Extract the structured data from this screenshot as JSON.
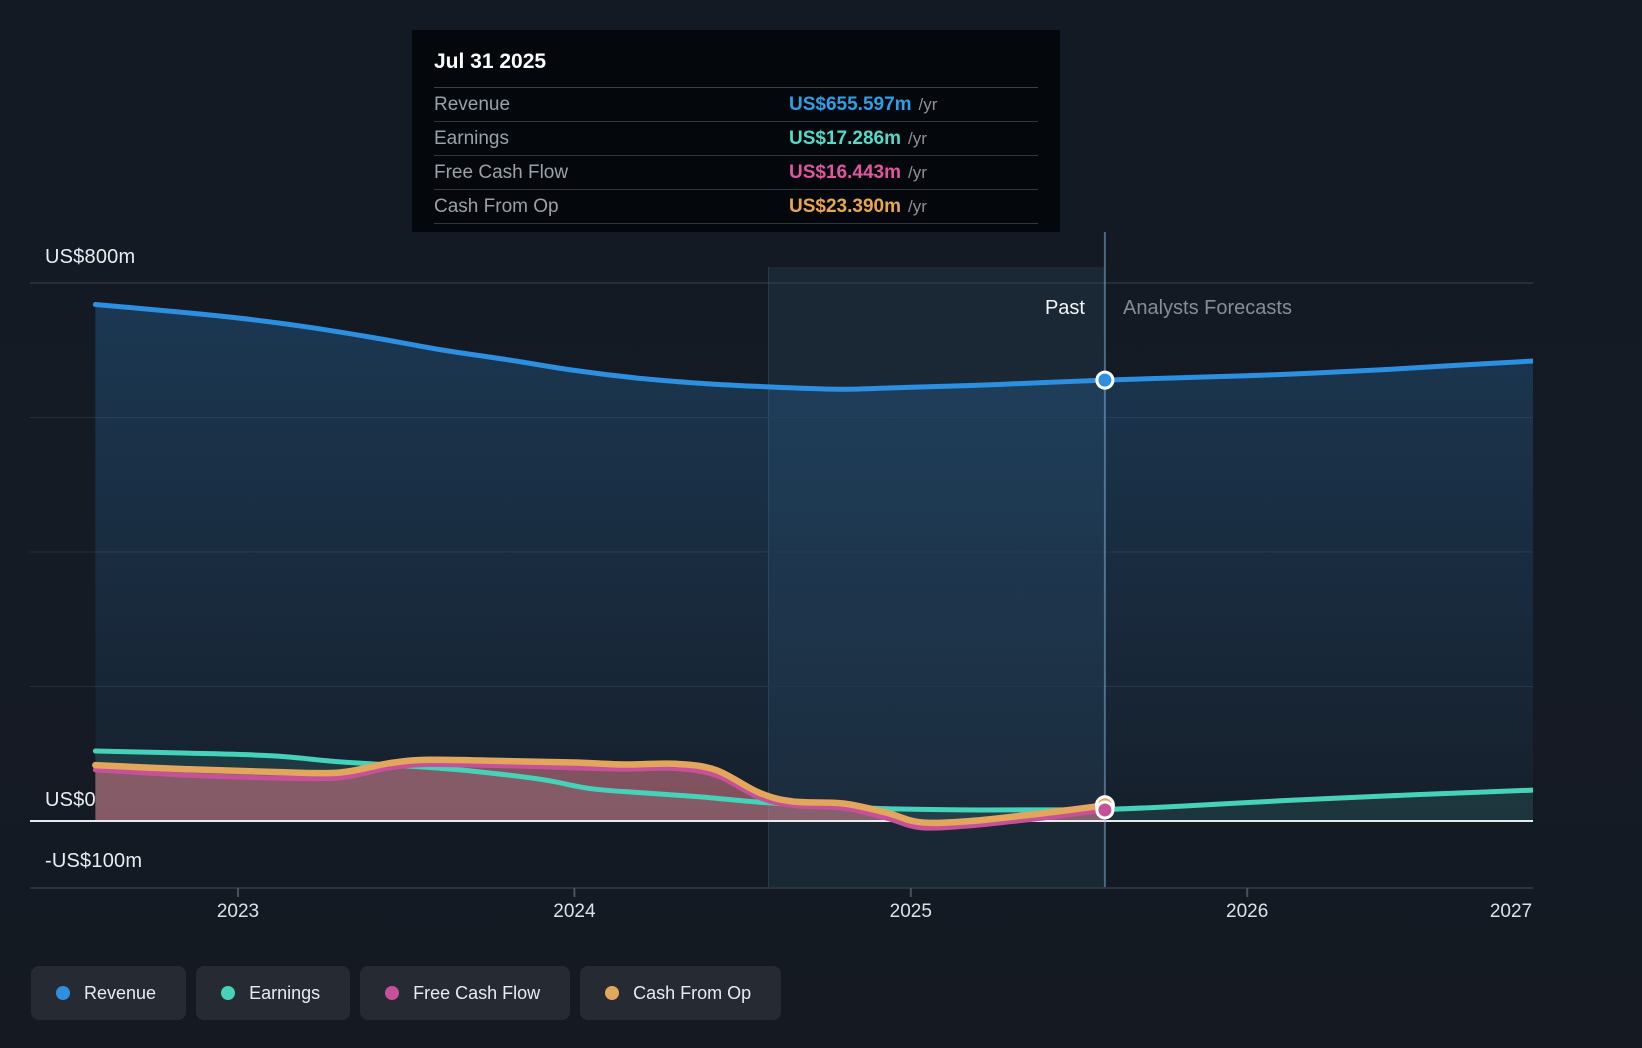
{
  "tooltip": {
    "date": "Jul 31 2025",
    "rows": [
      {
        "label": "Revenue",
        "value": "US$655.597m",
        "unit": "/yr",
        "color": "#2da0e8"
      },
      {
        "label": "Earnings",
        "value": "US$17.286m",
        "unit": "/yr",
        "color": "#52dcc8"
      },
      {
        "label": "Free Cash Flow",
        "value": "US$16.443m",
        "unit": "/yr",
        "color": "#e2559f"
      },
      {
        "label": "Cash From Op",
        "value": "US$23.390m",
        "unit": "/yr",
        "color": "#eaa64f"
      }
    ]
  },
  "annotations": {
    "past_label": "Past",
    "forecast_label": "Analysts Forecasts"
  },
  "y_axis": {
    "top_label": "US$800m",
    "zero_label": "US$0",
    "bottom_label": "-US$100m"
  },
  "legend": [
    {
      "label": "Revenue",
      "color": "#2d8fe0"
    },
    {
      "label": "Earnings",
      "color": "#46d2b9"
    },
    {
      "label": "Free Cash Flow",
      "color": "#c75198"
    },
    {
      "label": "Cash From Op",
      "color": "#e2a65c"
    }
  ],
  "chart_data": {
    "type": "area",
    "title": "Revenue, earnings and cash flow history and forecast (US$m)",
    "ylim": [
      -100,
      800
    ],
    "y_gridlines": [
      800,
      600,
      400,
      200,
      0
    ],
    "x_ticks": [
      2023,
      2024,
      2025,
      2026,
      2027
    ],
    "grid": true,
    "legend_position": "bottom",
    "divider_x": 2025.577,
    "highlight_band": [
      2024.577,
      2025.577
    ],
    "past_region_end": 2025.577,
    "series": [
      {
        "name": "Revenue",
        "color": "#2d8fe0",
        "points": [
          [
            2022.576,
            768
          ],
          [
            2022.8,
            758
          ],
          [
            2023.0,
            748
          ],
          [
            2023.2,
            735
          ],
          [
            2023.4,
            719
          ],
          [
            2023.6,
            701
          ],
          [
            2023.8,
            686
          ],
          [
            2024.0,
            670
          ],
          [
            2024.2,
            658
          ],
          [
            2024.4,
            650
          ],
          [
            2024.6,
            645
          ],
          [
            2024.8,
            642
          ],
          [
            2025.0,
            645
          ],
          [
            2025.2,
            648
          ],
          [
            2025.4,
            652
          ],
          [
            2025.577,
            655.597
          ],
          [
            2025.8,
            659
          ],
          [
            2026.1,
            664
          ],
          [
            2026.4,
            671
          ],
          [
            2026.6,
            677
          ],
          [
            2026.85,
            684
          ]
        ]
      },
      {
        "name": "Earnings",
        "color": "#46d2b9",
        "points": [
          [
            2022.576,
            104
          ],
          [
            2022.85,
            101
          ],
          [
            2023.1,
            97
          ],
          [
            2023.3,
            88
          ],
          [
            2023.5,
            82
          ],
          [
            2023.7,
            74
          ],
          [
            2023.9,
            62
          ],
          [
            2024.05,
            48
          ],
          [
            2024.2,
            42
          ],
          [
            2024.37,
            36
          ],
          [
            2024.55,
            28
          ],
          [
            2024.75,
            22
          ],
          [
            2024.95,
            18
          ],
          [
            2025.15,
            16.5
          ],
          [
            2025.35,
            16.5
          ],
          [
            2025.577,
            17.286
          ],
          [
            2025.8,
            22
          ],
          [
            2026.1,
            30
          ],
          [
            2026.4,
            37
          ],
          [
            2026.6,
            41
          ],
          [
            2026.85,
            46
          ]
        ]
      },
      {
        "name": "Free Cash Flow",
        "color": "#c75198",
        "points": [
          [
            2022.576,
            76
          ],
          [
            2022.85,
            68
          ],
          [
            2023.1,
            64
          ],
          [
            2023.3,
            64
          ],
          [
            2023.45,
            79
          ],
          [
            2023.57,
            84
          ],
          [
            2023.8,
            82
          ],
          [
            2024.0,
            79
          ],
          [
            2024.15,
            77
          ],
          [
            2024.3,
            78
          ],
          [
            2024.42,
            68
          ],
          [
            2024.55,
            35
          ],
          [
            2024.65,
            23
          ],
          [
            2024.8,
            19
          ],
          [
            2024.93,
            4
          ],
          [
            2025.03,
            -10
          ],
          [
            2025.18,
            -7
          ],
          [
            2025.35,
            2
          ],
          [
            2025.45,
            8
          ],
          [
            2025.577,
            16.443
          ]
        ]
      },
      {
        "name": "Cash From Op",
        "color": "#e2a65c",
        "points": [
          [
            2022.576,
            83
          ],
          [
            2022.85,
            77
          ],
          [
            2023.1,
            73
          ],
          [
            2023.3,
            72
          ],
          [
            2023.45,
            86
          ],
          [
            2023.57,
            91
          ],
          [
            2023.8,
            89
          ],
          [
            2024.0,
            87
          ],
          [
            2024.15,
            84
          ],
          [
            2024.3,
            85
          ],
          [
            2024.42,
            76
          ],
          [
            2024.55,
            42
          ],
          [
            2024.65,
            29
          ],
          [
            2024.8,
            26
          ],
          [
            2024.93,
            12
          ],
          [
            2025.03,
            -2
          ],
          [
            2025.18,
            0
          ],
          [
            2025.35,
            9
          ],
          [
            2025.45,
            15
          ],
          [
            2025.577,
            23.39
          ]
        ]
      }
    ],
    "markers": [
      {
        "series": "Revenue",
        "x": 2025.577,
        "y": 655.597
      },
      {
        "series": "Cash From Op",
        "x": 2025.577,
        "y": 23.39
      },
      {
        "series": "Free Cash Flow",
        "x": 2025.577,
        "y": 16.443
      }
    ]
  }
}
